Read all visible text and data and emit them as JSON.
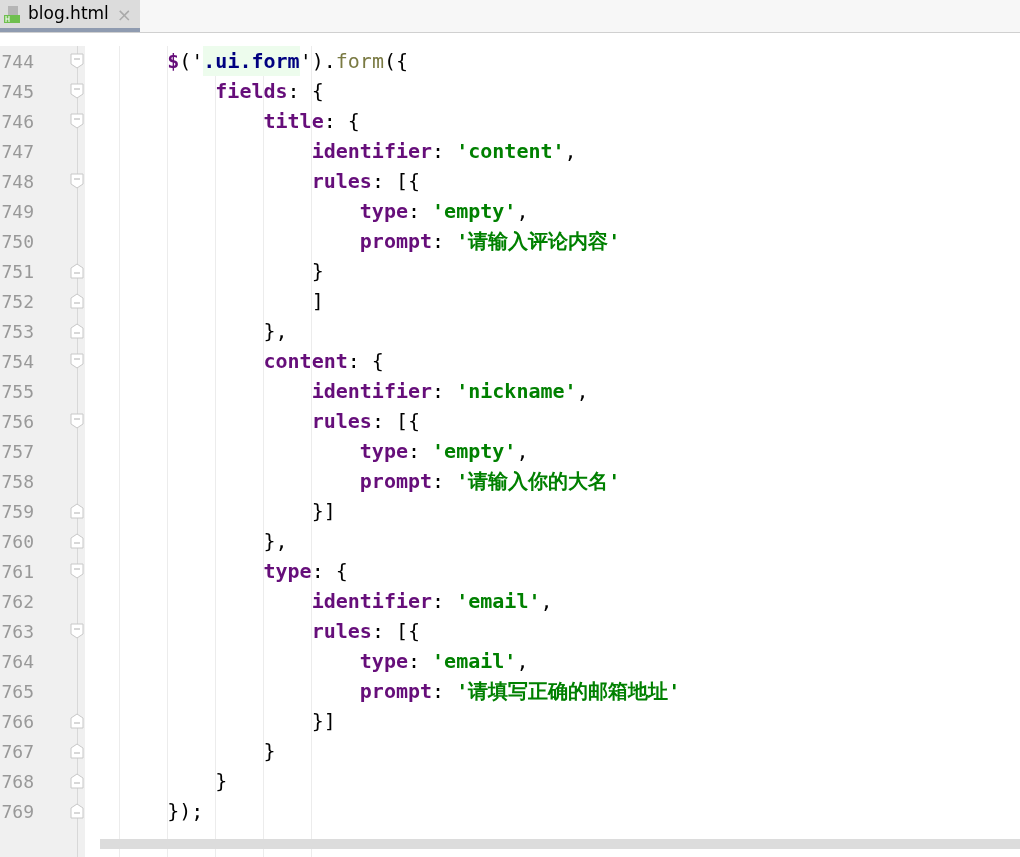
{
  "tabs": [
    {
      "label": "blog.html",
      "selected": true,
      "close": "×"
    }
  ],
  "editor": {
    "lines": [
      {
        "number": "744",
        "fold_start": true,
        "fold_end": false,
        "tokens": [
          {
            "kind": "dollar",
            "text": "    $"
          },
          {
            "kind": "plain",
            "text": "('"
          },
          {
            "kind": "selector",
            "text": ".ui.form"
          },
          {
            "kind": "plain",
            "text": "')."
          },
          {
            "kind": "method",
            "text": "form"
          },
          {
            "kind": "plain",
            "text": "({"
          }
        ]
      },
      {
        "number": "745",
        "fold_start": true,
        "fold_end": false,
        "tokens": [
          {
            "kind": "key",
            "text": "        fields"
          },
          {
            "kind": "plain",
            "text": ": {"
          }
        ]
      },
      {
        "number": "746",
        "fold_start": true,
        "fold_end": false,
        "tokens": [
          {
            "kind": "key",
            "text": "            title"
          },
          {
            "kind": "plain",
            "text": ": {"
          }
        ]
      },
      {
        "number": "747",
        "fold_start": false,
        "fold_end": false,
        "tokens": [
          {
            "kind": "key",
            "text": "                identifier"
          },
          {
            "kind": "plain",
            "text": ": "
          },
          {
            "kind": "string",
            "text": "'content'"
          },
          {
            "kind": "plain",
            "text": ","
          }
        ]
      },
      {
        "number": "748",
        "fold_start": true,
        "fold_end": false,
        "tokens": [
          {
            "kind": "key",
            "text": "                rules"
          },
          {
            "kind": "plain",
            "text": ": [{"
          }
        ]
      },
      {
        "number": "749",
        "fold_start": false,
        "fold_end": false,
        "tokens": [
          {
            "kind": "key",
            "text": "                    type"
          },
          {
            "kind": "plain",
            "text": ": "
          },
          {
            "kind": "string",
            "text": "'empty'"
          },
          {
            "kind": "plain",
            "text": ","
          }
        ]
      },
      {
        "number": "750",
        "fold_start": false,
        "fold_end": false,
        "tokens": [
          {
            "kind": "key",
            "text": "                    prompt"
          },
          {
            "kind": "plain",
            "text": ": "
          },
          {
            "kind": "string",
            "text": "'请输入评论内容'"
          }
        ]
      },
      {
        "number": "751",
        "fold_start": false,
        "fold_end": true,
        "tokens": [
          {
            "kind": "plain",
            "text": "                }"
          }
        ]
      },
      {
        "number": "752",
        "fold_start": false,
        "fold_end": true,
        "tokens": [
          {
            "kind": "plain",
            "text": "                ]"
          }
        ]
      },
      {
        "number": "753",
        "fold_start": false,
        "fold_end": true,
        "tokens": [
          {
            "kind": "plain",
            "text": "            },"
          }
        ]
      },
      {
        "number": "754",
        "fold_start": true,
        "fold_end": false,
        "tokens": [
          {
            "kind": "key",
            "text": "            content"
          },
          {
            "kind": "plain",
            "text": ": {"
          }
        ]
      },
      {
        "number": "755",
        "fold_start": false,
        "fold_end": false,
        "tokens": [
          {
            "kind": "key",
            "text": "                identifier"
          },
          {
            "kind": "plain",
            "text": ": "
          },
          {
            "kind": "string",
            "text": "'nickname'"
          },
          {
            "kind": "plain",
            "text": ","
          }
        ]
      },
      {
        "number": "756",
        "fold_start": true,
        "fold_end": false,
        "tokens": [
          {
            "kind": "key",
            "text": "                rules"
          },
          {
            "kind": "plain",
            "text": ": [{"
          }
        ]
      },
      {
        "number": "757",
        "fold_start": false,
        "fold_end": false,
        "tokens": [
          {
            "kind": "key",
            "text": "                    type"
          },
          {
            "kind": "plain",
            "text": ": "
          },
          {
            "kind": "string",
            "text": "'empty'"
          },
          {
            "kind": "plain",
            "text": ","
          }
        ]
      },
      {
        "number": "758",
        "fold_start": false,
        "fold_end": false,
        "tokens": [
          {
            "kind": "key",
            "text": "                    prompt"
          },
          {
            "kind": "plain",
            "text": ": "
          },
          {
            "kind": "string",
            "text": "'请输入你的大名'"
          }
        ]
      },
      {
        "number": "759",
        "fold_start": false,
        "fold_end": true,
        "tokens": [
          {
            "kind": "plain",
            "text": "                }]"
          }
        ]
      },
      {
        "number": "760",
        "fold_start": false,
        "fold_end": true,
        "tokens": [
          {
            "kind": "plain",
            "text": "            },"
          }
        ]
      },
      {
        "number": "761",
        "fold_start": true,
        "fold_end": false,
        "tokens": [
          {
            "kind": "key",
            "text": "            type"
          },
          {
            "kind": "plain",
            "text": ": {"
          }
        ]
      },
      {
        "number": "762",
        "fold_start": false,
        "fold_end": false,
        "tokens": [
          {
            "kind": "key",
            "text": "                identifier"
          },
          {
            "kind": "plain",
            "text": ": "
          },
          {
            "kind": "string",
            "text": "'email'"
          },
          {
            "kind": "plain",
            "text": ","
          }
        ]
      },
      {
        "number": "763",
        "fold_start": true,
        "fold_end": false,
        "tokens": [
          {
            "kind": "key",
            "text": "                rules"
          },
          {
            "kind": "plain",
            "text": ": [{"
          }
        ]
      },
      {
        "number": "764",
        "fold_start": false,
        "fold_end": false,
        "tokens": [
          {
            "kind": "key",
            "text": "                    type"
          },
          {
            "kind": "plain",
            "text": ": "
          },
          {
            "kind": "string",
            "text": "'email'"
          },
          {
            "kind": "plain",
            "text": ","
          }
        ]
      },
      {
        "number": "765",
        "fold_start": false,
        "fold_end": false,
        "tokens": [
          {
            "kind": "key",
            "text": "                    prompt"
          },
          {
            "kind": "plain",
            "text": ": "
          },
          {
            "kind": "string",
            "text": "'请填写正确的邮箱地址'"
          }
        ]
      },
      {
        "number": "766",
        "fold_start": false,
        "fold_end": true,
        "tokens": [
          {
            "kind": "plain",
            "text": "                }]"
          }
        ]
      },
      {
        "number": "767",
        "fold_start": false,
        "fold_end": true,
        "tokens": [
          {
            "kind": "plain",
            "text": "            }"
          }
        ]
      },
      {
        "number": "768",
        "fold_start": false,
        "fold_end": true,
        "tokens": [
          {
            "kind": "plain",
            "text": "        }"
          }
        ]
      },
      {
        "number": "769",
        "fold_start": false,
        "fold_end": true,
        "tokens": [
          {
            "kind": "plain",
            "text": "    });"
          }
        ]
      }
    ]
  }
}
